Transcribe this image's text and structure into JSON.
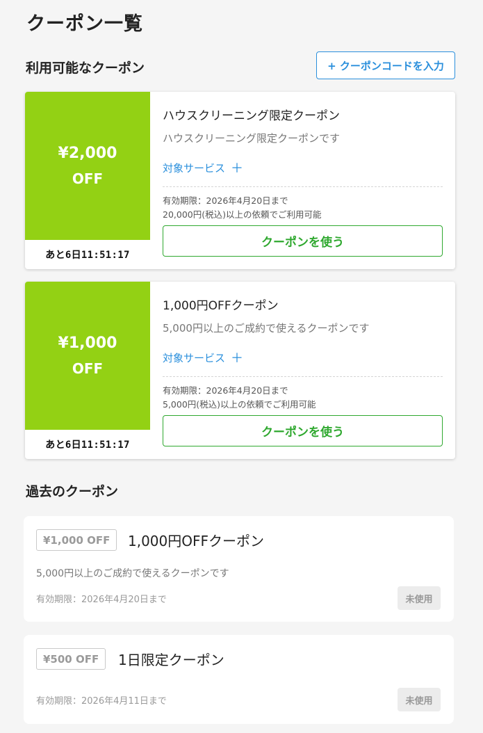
{
  "page_title": "クーポン一覧",
  "available": {
    "title": "利用可能なクーポン",
    "code_button_label": "+ クーポンコードを入力",
    "coupons": [
      {
        "amount": "¥2,000",
        "off": "OFF",
        "timer": "あと6日11:51:17",
        "name": "ハウスクリーニング限定クーポン",
        "description": "ハウスクリーニング限定クーポンです",
        "target_label": "対象サービス",
        "expiry": "有効期限：2026年4月20日まで",
        "condition": "20,000円(税込)以上の依頼でご利用可能",
        "use_label": "クーポンを使う"
      },
      {
        "amount": "¥1,000",
        "off": "OFF",
        "timer": "あと6日11:51:17",
        "name": "1,000円OFFクーポン",
        "description": "5,000円以上のご成約で使えるクーポンです",
        "target_label": "対象サービス",
        "expiry": "有効期限：2026年4月20日まで",
        "condition": "5,000円(税込)以上の依頼でご利用可能",
        "use_label": "クーポンを使う"
      }
    ]
  },
  "past": {
    "title": "過去のクーポン",
    "coupons": [
      {
        "badge": "¥1,000 OFF",
        "name": "1,000円OFFクーポン",
        "description": "5,000円以上のご成約で使えるクーポンです",
        "expiry": "有効期限：2026年4月20日まで",
        "status": "未使用"
      },
      {
        "badge": "¥500 OFF",
        "name": "1日限定クーポン",
        "description": "",
        "expiry": "有効期限：2026年4月11日まで",
        "status": "未使用"
      }
    ]
  },
  "colors": {
    "accent_green": "#93d114",
    "button_green": "#2fa82f",
    "link_blue": "#2a8fdc"
  },
  "icons": {
    "plus": "plus-icon"
  }
}
